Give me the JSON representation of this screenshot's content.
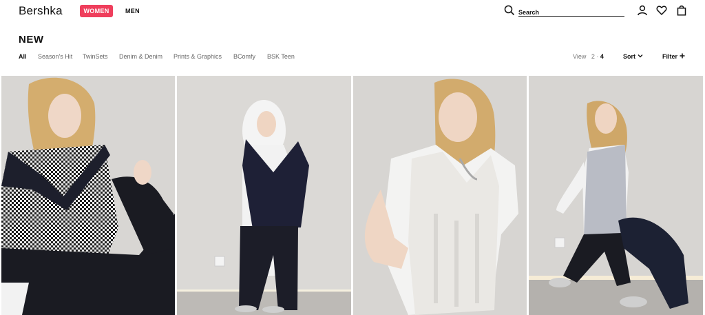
{
  "header": {
    "logo": "Bershka",
    "tabs": [
      {
        "label": "WOMEN",
        "active": true
      },
      {
        "label": "MEN",
        "active": false
      }
    ],
    "search": {
      "placeholder": "Search",
      "value": ""
    },
    "icons": [
      "search-icon",
      "user-icon",
      "heart-icon",
      "bag-icon"
    ],
    "accent_color": "#ef3e5c"
  },
  "page": {
    "title": "NEW",
    "filters": [
      {
        "label": "All",
        "active": true
      },
      {
        "label": "Season's Hit",
        "active": false
      },
      {
        "label": "TwinSets",
        "active": false
      },
      {
        "label": "Denim & Denim",
        "active": false
      },
      {
        "label": "Prints & Graphics",
        "active": false
      },
      {
        "label": "BComfy",
        "active": false
      },
      {
        "label": "BSK Teen",
        "active": false
      }
    ],
    "view": {
      "label": "View",
      "options": [
        "2",
        "4"
      ],
      "selected": "4"
    },
    "sort_label": "Sort",
    "filter_label": "Filter"
  },
  "products": [
    {
      "image": "model-houndstooth-vest"
    },
    {
      "image": "model-navy-vest-hoodie"
    },
    {
      "image": "model-white-cable-knit-vest"
    },
    {
      "image": "model-grey-vest-walking"
    }
  ]
}
